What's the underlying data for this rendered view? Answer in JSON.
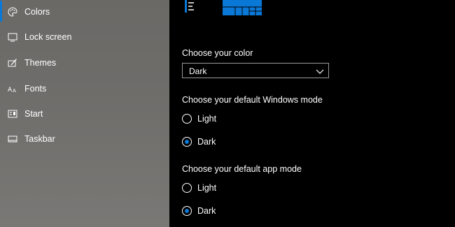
{
  "colors": {
    "accent": "#0a78d7",
    "sidebar_bg": "#6f6d6a",
    "main_bg": "#000000"
  },
  "sidebar": {
    "items": [
      {
        "label": "Colors",
        "icon": "palette-icon",
        "active": true
      },
      {
        "label": "Lock screen",
        "icon": "lock-screen-icon"
      },
      {
        "label": "Themes",
        "icon": "brush-icon"
      },
      {
        "label": "Fonts",
        "icon": "fonts-icon"
      },
      {
        "label": "Start",
        "icon": "start-icon"
      },
      {
        "label": "Taskbar",
        "icon": "taskbar-icon"
      }
    ]
  },
  "main": {
    "color_section": {
      "title": "Choose your color",
      "selected": "Dark"
    },
    "windows_mode": {
      "title": "Choose your default Windows mode",
      "options": [
        {
          "label": "Light",
          "checked": false
        },
        {
          "label": "Dark",
          "checked": true
        }
      ]
    },
    "app_mode": {
      "title": "Choose your default app mode",
      "options": [
        {
          "label": "Light",
          "checked": false
        },
        {
          "label": "Dark",
          "checked": true
        }
      ]
    }
  }
}
